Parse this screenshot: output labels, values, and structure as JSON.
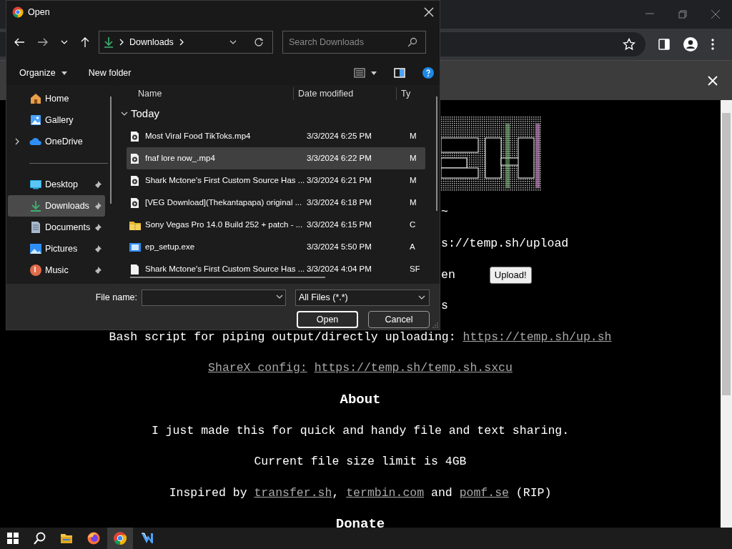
{
  "dialog": {
    "title": "Open",
    "address": "Downloads",
    "search": {
      "placeholder": "Search Downloads"
    },
    "commands": [
      "Organize",
      "New folder"
    ],
    "sidebar": {
      "groups": [
        [
          {
            "label": "Home",
            "kind": "home",
            "selected": false,
            "pinned": false,
            "expandable": false
          },
          {
            "label": "Gallery",
            "kind": "gallery",
            "selected": false,
            "pinned": false,
            "expandable": false
          },
          {
            "label": "OneDrive",
            "kind": "cloud",
            "selected": false,
            "pinned": false,
            "expandable": true
          }
        ],
        [
          {
            "label": "Desktop",
            "kind": "desktop",
            "selected": false,
            "pinned": true,
            "expandable": false
          },
          {
            "label": "Downloads",
            "kind": "download",
            "selected": true,
            "pinned": true,
            "expandable": false
          },
          {
            "label": "Documents",
            "kind": "documents",
            "selected": false,
            "pinned": true,
            "expandable": false
          },
          {
            "label": "Pictures",
            "kind": "pictures",
            "selected": false,
            "pinned": true,
            "expandable": false
          },
          {
            "label": "Music",
            "kind": "music",
            "selected": false,
            "pinned": true,
            "expandable": false
          }
        ]
      ]
    },
    "columns": [
      "Name",
      "Date modified",
      "Ty"
    ],
    "group": {
      "label": "Today",
      "expanded": true
    },
    "files": [
      {
        "name": "Most Viral Food TikToks.mp4",
        "date": "3/3/2024 6:25 PM",
        "column_3": "M",
        "kind": "video",
        "selected": false
      },
      {
        "name": "fnaf lore now_.mp4",
        "date": "3/3/2024 6:22 PM",
        "column_3": "M",
        "kind": "video",
        "selected": true
      },
      {
        "name": "Shark Mctone's First Custom Source Has ...",
        "date": "3/3/2024 6:21 PM",
        "column_3": "M",
        "kind": "video",
        "selected": false
      },
      {
        "name": "[VEG Download](Thekantapapa) original ...",
        "date": "3/3/2024 6:18 PM",
        "column_3": "M",
        "kind": "video",
        "selected": false
      },
      {
        "name": "Sony Vegas Pro 14.0 Build 252 + patch - ...",
        "date": "3/3/2024 6:15 PM",
        "column_3": "C",
        "kind": "zip",
        "selected": false
      },
      {
        "name": "ep_setup.exe",
        "date": "3/3/2024 5:50 PM",
        "column_3": "A",
        "kind": "app",
        "selected": false
      },
      {
        "name": "Shark Mctone's First Custom Source Has ...",
        "date": "3/3/2024 4:04 PM",
        "column_3": "SF",
        "kind": "file",
        "selected": false
      }
    ],
    "file_name": {
      "label": "File name:"
    },
    "filter": "All Files (*.*)",
    "buttons": [
      "Open",
      "Cancel"
    ]
  },
  "page": {
    "lines": [
      {
        "kind": "partial",
        "parts": [
          {
            "text": "~",
            "link": false
          }
        ]
      },
      {
        "kind": "partial",
        "parts": [
          {
            "text": "s://temp.sh/upload",
            "link": false
          }
        ]
      },
      {
        "kind": "partial",
        "parts": [
          {
            "text": "en",
            "link": false
          }
        ],
        "button": "Upload!"
      },
      {
        "kind": "partial",
        "parts": [
          {
            "text": "s",
            "link": false
          }
        ]
      },
      {
        "kind": "center",
        "parts": [
          {
            "text": "Bash script for piping output/directly uploading: ",
            "link": false
          },
          {
            "text": "https://temp.sh/up.sh",
            "link": true
          }
        ]
      },
      {
        "kind": "center",
        "parts": [
          {
            "text": "ShareX config:",
            "link": true
          },
          {
            "text": "https://temp.sh/temp.sh.sxcu",
            "link": true
          }
        ]
      },
      {
        "kind": "heading",
        "parts": [
          {
            "text": "About",
            "link": false
          }
        ]
      },
      {
        "kind": "center",
        "parts": [
          {
            "text": "I just made this for quick and handy file and text sharing.",
            "link": false
          }
        ]
      },
      {
        "kind": "center",
        "parts": [
          {
            "text": "Current file size limit is 4GB",
            "link": false
          }
        ]
      },
      {
        "kind": "center",
        "parts": [
          {
            "text": "Inspired by ",
            "link": false
          },
          {
            "text": "transfer.sh",
            "link": true
          },
          {
            "text": ", ",
            "link": false
          },
          {
            "text": "termbin.com",
            "link": true
          },
          {
            "text": " and ",
            "link": false
          },
          {
            "text": "pomf.se",
            "link": true
          },
          {
            "text": " (RIP)",
            "link": false
          }
        ]
      },
      {
        "kind": "heading",
        "parts": [
          {
            "text": "Donate",
            "link": false
          }
        ]
      }
    ]
  }
}
